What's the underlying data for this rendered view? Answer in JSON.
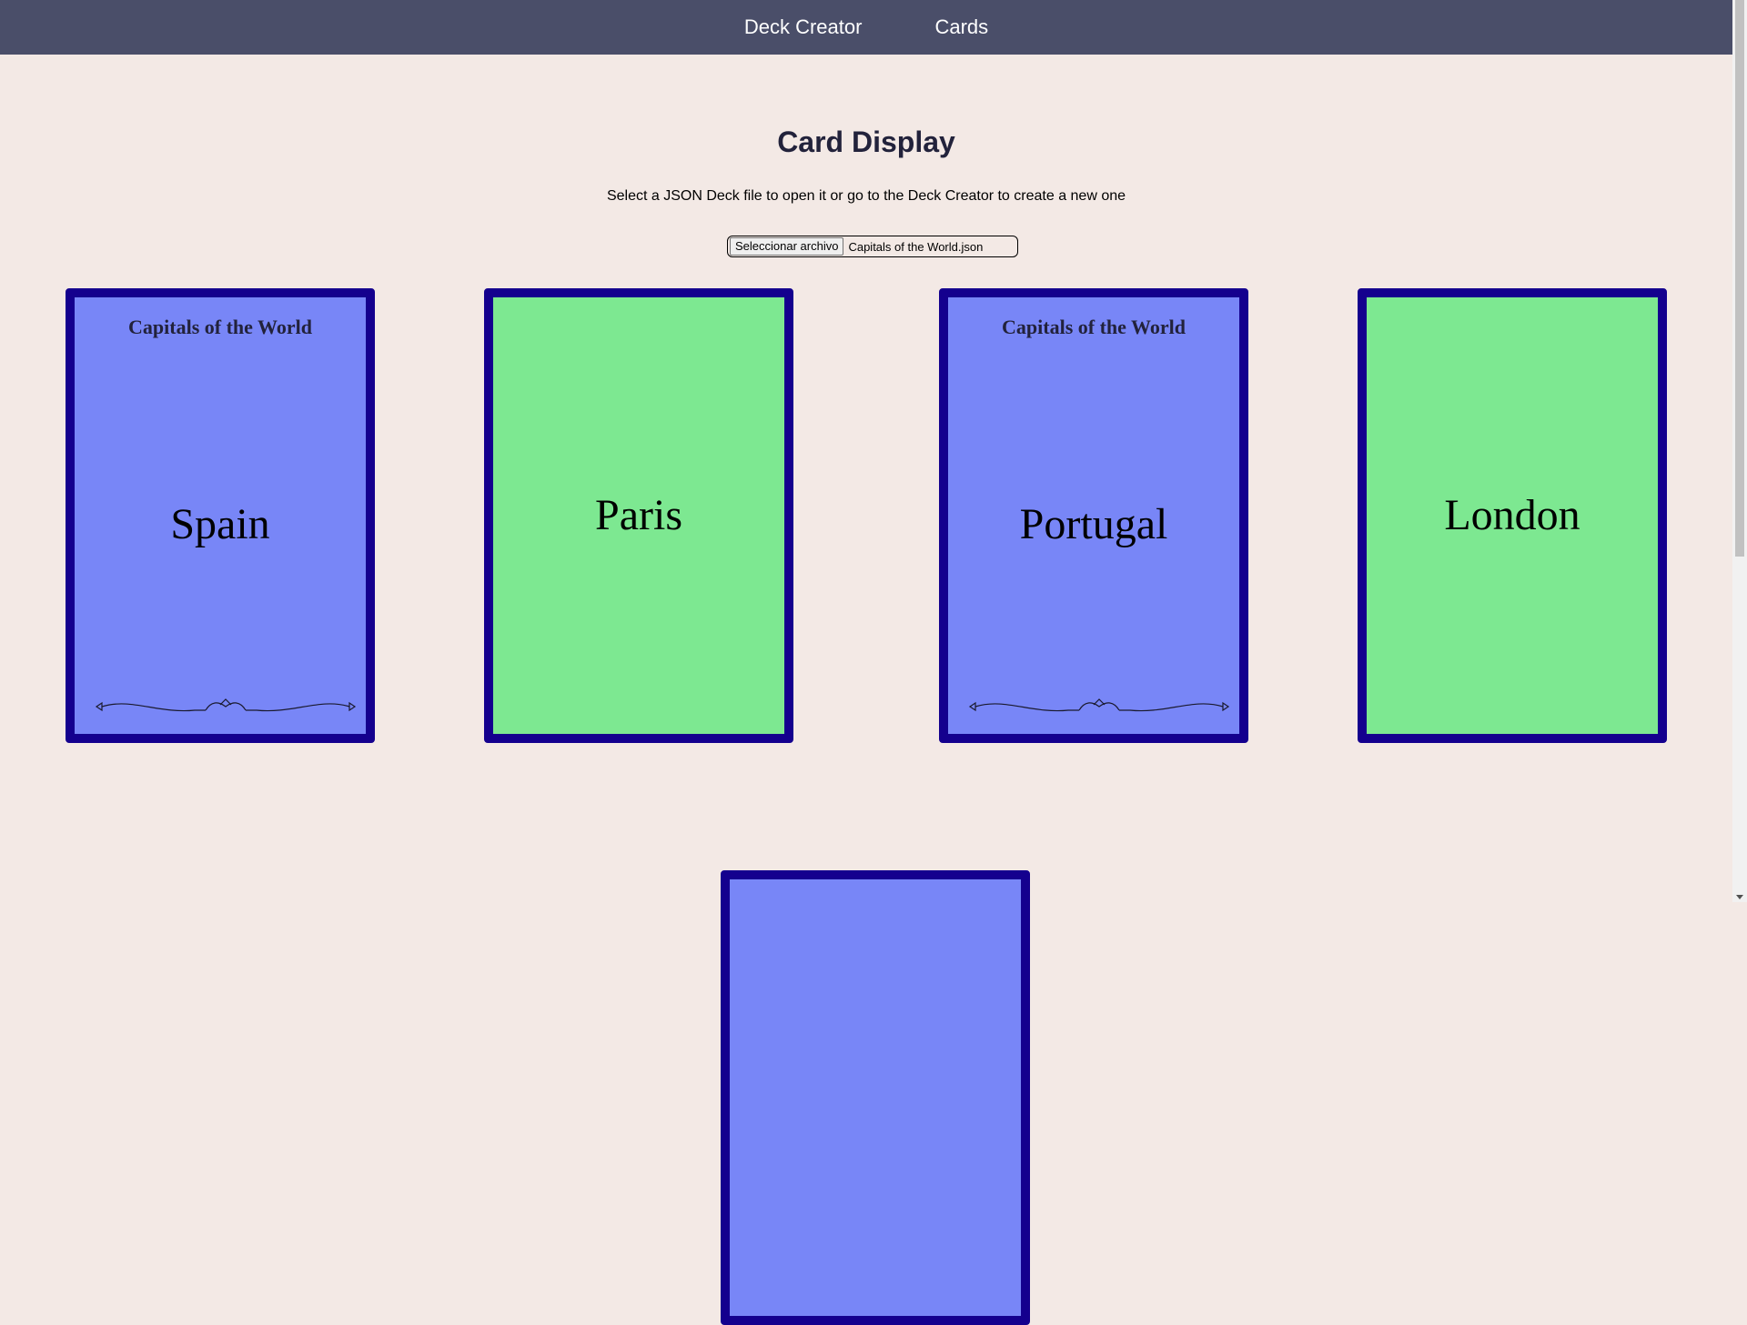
{
  "nav": {
    "deck_creator": "Deck Creator",
    "cards": "Cards"
  },
  "page": {
    "title": "Card Display",
    "instructions": "Select a JSON Deck file to open it or go to the Deck Creator to create a new one"
  },
  "file_picker": {
    "button_label": "Seleccionar archivo",
    "file_name": "Capitals of the World.json"
  },
  "cards": [
    {
      "side": "front",
      "deck_title": "Capitals of the World",
      "text": "Spain"
    },
    {
      "side": "back",
      "text": "Paris"
    },
    {
      "side": "front",
      "deck_title": "Capitals of the World",
      "text": "Portugal"
    },
    {
      "side": "back",
      "text": "London"
    },
    {
      "side": "front"
    }
  ],
  "colors": {
    "navbar": "#4a4e69",
    "background": "#f3e9e5",
    "card_border": "#14008e",
    "card_front": "#7886f7",
    "card_back": "#7de891"
  }
}
